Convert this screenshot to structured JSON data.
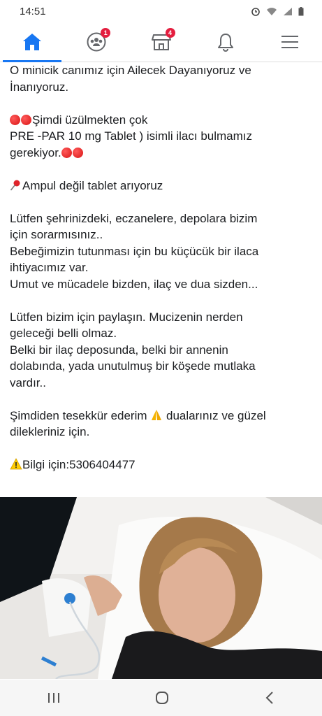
{
  "status_bar": {
    "time": "14:51"
  },
  "nav": {
    "tabs": [
      {
        "name": "home",
        "badge": ""
      },
      {
        "name": "groups",
        "badge": "1"
      },
      {
        "name": "marketplace",
        "badge": "4"
      },
      {
        "name": "notifications",
        "badge": ""
      },
      {
        "name": "menu",
        "badge": ""
      }
    ],
    "accent": "#1877f2",
    "badge_color": "#e41e3f"
  },
  "post": {
    "lines": {
      "l1": "O minicik canımız için Ailecek Dayanıyoruz ve",
      "l2": "İnanıyoruz.",
      "l3": "Şimdi üzülmekten çok",
      "l4": "PRE -PAR 10 mg Tablet ) isimli  ilacı bulmamız",
      "l5": "gerekiyor.",
      "l6": "Ampul değil tablet arıyoruz",
      "l7": "Lütfen şehrinizdeki, eczanelere, depolara bizim",
      "l8": "için sorarmısınız..",
      "l9": "Bebeğimizin tutunması için bu küçücük bir ilaca",
      "l10": "ihtiyacımız var.",
      "l11": "Umut ve mücadele bizden, ilaç ve dua sizden...",
      "l12": "Lütfen bizim için paylaşın. Mucizenin nerden",
      "l13": "geleceği belli olmaz.",
      "l14": "Belki bir ilaç deposunda, belki bir annenin",
      "l15": "dolabında, yada unutulmuş bir köşede mutlaka",
      "l16": "vardır..",
      "l17a": "Şimdiden tesekkür ederim ",
      "l17b": " dualarınız ve güzel",
      "l18": "dilekleriniz için.",
      "l19": "Bilgi için:5306404477"
    }
  },
  "icons": {
    "red_dot": "red-circle-emoji",
    "pin": "round-pushpin-emoji",
    "pray": "folded-hands-emoji",
    "warning": "warning-emoji"
  }
}
